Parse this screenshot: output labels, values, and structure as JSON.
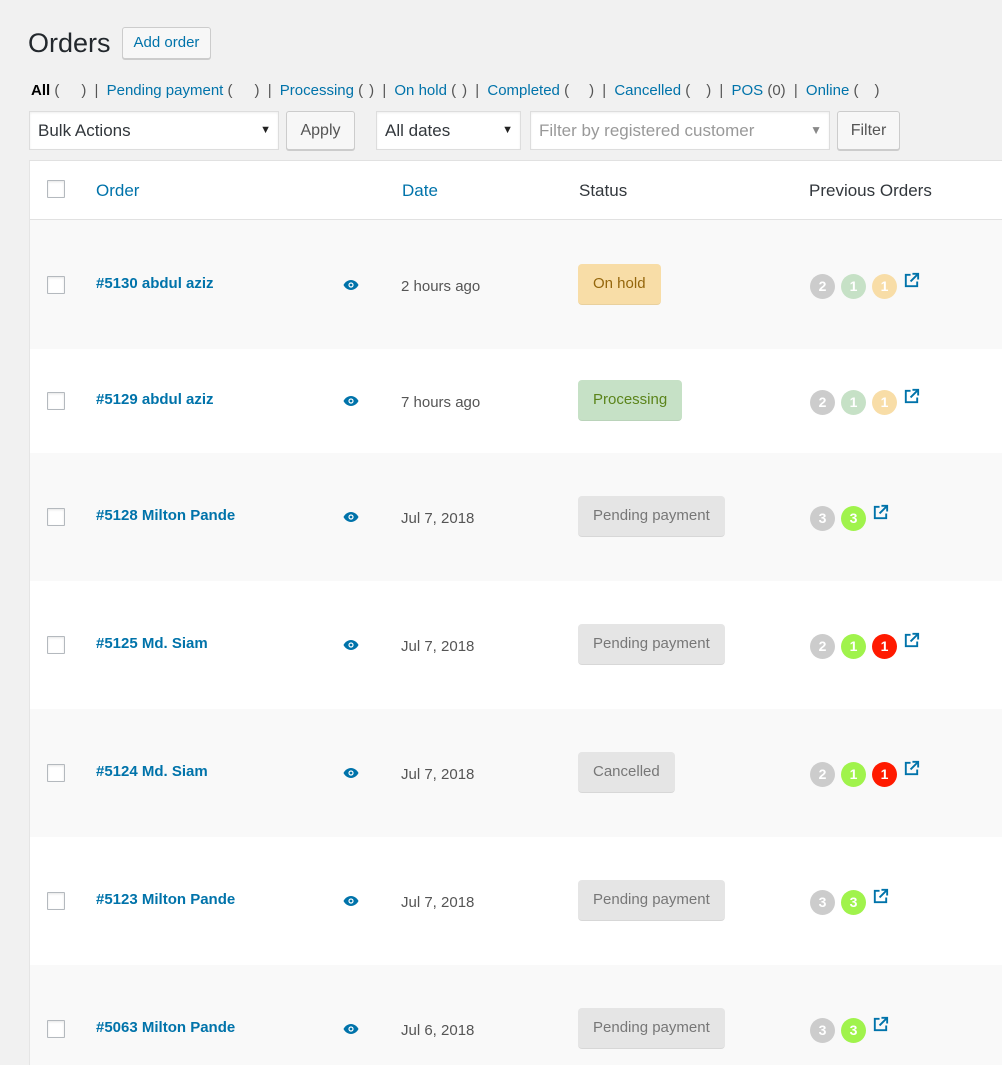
{
  "page": {
    "title": "Orders",
    "add_order_label": "Add order"
  },
  "filters": {
    "all_label": "All",
    "pending_label": "Pending payment",
    "processing_label": "Processing",
    "onhold_label": "On hold",
    "completed_label": "Completed",
    "cancelled_label": "Cancelled",
    "pos_label": "POS",
    "pos_count": "(0)",
    "online_label": "Online"
  },
  "toolbar": {
    "bulk_actions": "Bulk Actions",
    "apply": "Apply",
    "dates": "All dates",
    "customer_placeholder": "Filter by registered customer",
    "filter": "Filter"
  },
  "columns": {
    "order": "Order",
    "date": "Date",
    "status": "Status",
    "previous": "Previous Orders"
  },
  "colors": {
    "link": "#0073aa",
    "onhold_bg": "#f8dda7",
    "onhold_fg": "#94660c",
    "processing_bg": "#c6e1c6",
    "processing_fg": "#5b841b",
    "pending_bg": "#e5e5e5",
    "pending_fg": "#777777",
    "badge_gray": "#cccccc",
    "badge_lightgreen": "#c6e1c6",
    "badge_peach": "#f8dda7",
    "badge_green": "#a0f34c",
    "badge_red": "#ff1a00"
  },
  "orders": [
    {
      "label": "#5130 abdul aziz",
      "date": "2 hours ago",
      "status": "On hold",
      "status_key": "onhold",
      "badges": [
        {
          "v": "2",
          "c": "gray"
        },
        {
          "v": "1",
          "c": "lightgreen"
        },
        {
          "v": "1",
          "c": "peach"
        }
      ]
    },
    {
      "label": "#5129 abdul aziz",
      "date": "7 hours ago",
      "status": "Processing",
      "status_key": "processing",
      "badges": [
        {
          "v": "2",
          "c": "gray"
        },
        {
          "v": "1",
          "c": "lightgreen"
        },
        {
          "v": "1",
          "c": "peach"
        }
      ]
    },
    {
      "label": "#5128 Milton Pande",
      "date": "Jul 7, 2018",
      "status": "Pending payment",
      "status_key": "pending",
      "badges": [
        {
          "v": "3",
          "c": "gray"
        },
        {
          "v": "3",
          "c": "green"
        }
      ]
    },
    {
      "label": "#5125 Md. Siam",
      "date": "Jul 7, 2018",
      "status": "Pending payment",
      "status_key": "pending",
      "badges": [
        {
          "v": "2",
          "c": "gray"
        },
        {
          "v": "1",
          "c": "green"
        },
        {
          "v": "1",
          "c": "red"
        }
      ]
    },
    {
      "label": "#5124 Md. Siam",
      "date": "Jul 7, 2018",
      "status": "Cancelled",
      "status_key": "pending",
      "badges": [
        {
          "v": "2",
          "c": "gray"
        },
        {
          "v": "1",
          "c": "green"
        },
        {
          "v": "1",
          "c": "red"
        }
      ]
    },
    {
      "label": "#5123 Milton Pande",
      "date": "Jul 7, 2018",
      "status": "Pending payment",
      "status_key": "pending",
      "badges": [
        {
          "v": "3",
          "c": "gray"
        },
        {
          "v": "3",
          "c": "green"
        }
      ]
    },
    {
      "label": "#5063 Milton Pande",
      "date": "Jul 6, 2018",
      "status": "Pending payment",
      "status_key": "pending",
      "badges": [
        {
          "v": "3",
          "c": "gray"
        },
        {
          "v": "3",
          "c": "green"
        }
      ]
    }
  ]
}
